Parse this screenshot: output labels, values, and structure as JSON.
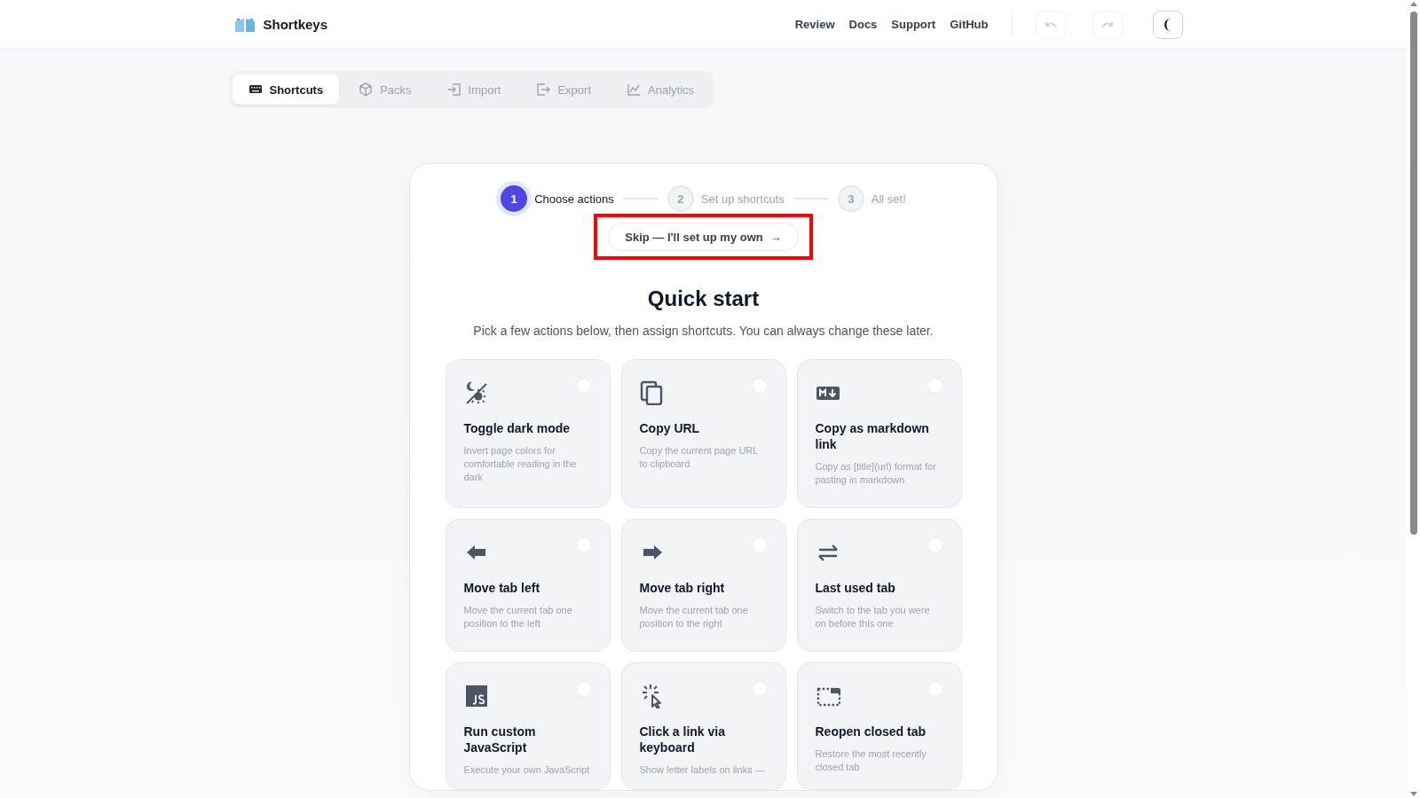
{
  "header": {
    "brand": "Shortkeys",
    "nav": [
      "Review",
      "Docs",
      "Support",
      "GitHub"
    ]
  },
  "tabs": [
    {
      "label": "Shortcuts",
      "selected": true
    },
    {
      "label": "Packs",
      "selected": false
    },
    {
      "label": "Import",
      "selected": false
    },
    {
      "label": "Export",
      "selected": false
    },
    {
      "label": "Analytics",
      "selected": false
    }
  ],
  "wizard": {
    "steps": [
      {
        "number": "1",
        "label": "Choose actions",
        "current": true
      },
      {
        "number": "2",
        "label": "Set up shortcuts",
        "current": false
      },
      {
        "number": "3",
        "label": "All set!",
        "current": false
      }
    ],
    "skip_button": "Skip — I'll set up my own",
    "skip_arrow": "→",
    "title": "Quick start",
    "subtitle": "Pick a few actions below, then assign shortcuts. You can always change these later.",
    "actions": [
      {
        "title": "Toggle dark mode",
        "description": "Invert page colors for comfortable reading in the dark",
        "selected": false
      },
      {
        "title": "Copy URL",
        "description": "Copy the current page URL to clipboard",
        "selected": false
      },
      {
        "title": "Copy as markdown link",
        "description": "Copy as [title](url) format for pasting in markdown",
        "selected": false
      },
      {
        "title": "Move tab left",
        "description": "Move the current tab one position to the left",
        "selected": false
      },
      {
        "title": "Move tab right",
        "description": "Move the current tab one position to the right",
        "selected": false
      },
      {
        "title": "Last used tab",
        "description": "Switch to the tab you were on before this one",
        "selected": false
      },
      {
        "title": "Run custom JavaScript",
        "description": "Execute your own JavaScript",
        "selected": false
      },
      {
        "title": "Click a link via keyboard",
        "description": "Show letter labels on links —",
        "selected": false
      },
      {
        "title": "Reopen closed tab",
        "description": "Restore the most recently closed tab",
        "selected": false
      }
    ]
  }
}
